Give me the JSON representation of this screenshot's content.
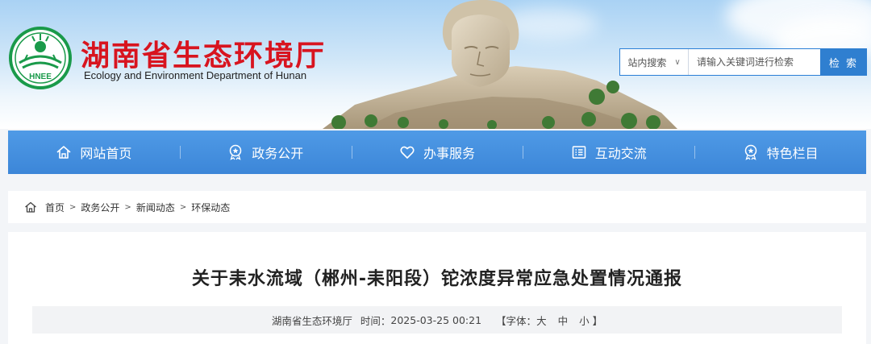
{
  "header": {
    "title_cn": "湖南省生态环境厅",
    "title_en": "Ecology and Environment Department of Hunan",
    "logo_text": "HNEE"
  },
  "search": {
    "scope_label": "站内搜索",
    "scope_chevron": "∨",
    "placeholder": "请输入关键词进行检索",
    "button_label": "检 索"
  },
  "nav": {
    "items": [
      {
        "label": "网站首页",
        "icon": "home-icon"
      },
      {
        "label": "政务公开",
        "icon": "badge-icon"
      },
      {
        "label": "办事服务",
        "icon": "heart-icon"
      },
      {
        "label": "互动交流",
        "icon": "list-icon"
      },
      {
        "label": "特色栏目",
        "icon": "badge-icon"
      }
    ]
  },
  "breadcrumb": {
    "items": [
      "首页",
      "政务公开",
      "新闻动态",
      "环保动态"
    ],
    "separator": ">"
  },
  "article": {
    "title": "关于耒水流域（郴州-耒阳段）铊浓度异常应急处置情况通报",
    "source": "湖南省生态环境厅",
    "time_label": "时间：",
    "time_value": "2025-03-25 00:21",
    "font_open": "【字体：",
    "font_large": "大",
    "font_medium": "中",
    "font_small": "小",
    "font_close": "】"
  },
  "colors": {
    "brand_red": "#d8141f",
    "nav_blue": "#3c86d8",
    "search_blue": "#2f7fd0",
    "logo_green": "#1a9a4a"
  }
}
